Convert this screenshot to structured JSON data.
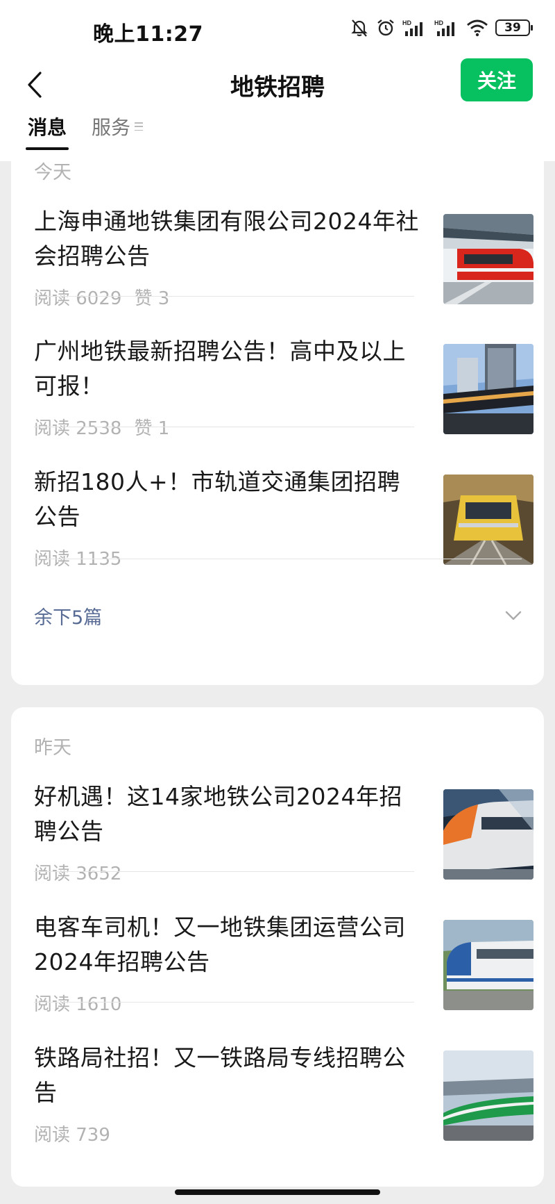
{
  "status_bar": {
    "time": "晚上11:27",
    "battery": "39",
    "icons": [
      "mute-bell-icon",
      "alarm-icon",
      "signal-hd-icon",
      "signal-hd-icon",
      "wifi-icon",
      "battery-icon"
    ]
  },
  "header": {
    "title": "地铁招聘",
    "follow_label": "关注",
    "back_icon": "chevron-left-icon"
  },
  "tabs": [
    {
      "label": "消息",
      "active": true
    },
    {
      "label": "服务",
      "active": false
    }
  ],
  "groups": [
    {
      "date": "今天",
      "articles": [
        {
          "title": "上海申通地铁集团有限公司2024年社会招聘公告",
          "reads": "阅读 6029",
          "likes": "赞 3",
          "thumb": "red-metro-platform"
        },
        {
          "title": "广州地铁最新招聘公告！高中及以上可报！",
          "reads": "阅读 2538",
          "likes": "赞 1",
          "thumb": "elevated-train-city"
        },
        {
          "title": "新招180人+！市轨道交通集团招聘公告",
          "reads": "阅读 1135",
          "likes": "",
          "thumb": "yellow-train-tunnel"
        }
      ],
      "more_label": "余下5篇"
    },
    {
      "date": "昨天",
      "articles": [
        {
          "title": "好机遇！这14家地铁公司2024年招聘公告",
          "reads": "阅读 3652",
          "likes": "",
          "thumb": "white-orange-train"
        },
        {
          "title": "电客车司机！又一地铁集团运营公司2024年招聘公告",
          "reads": "阅读 1610",
          "likes": "",
          "thumb": "blue-white-train"
        },
        {
          "title": "铁路局社招！又一铁路局专线招聘公告",
          "reads": "阅读 739",
          "likes": "",
          "thumb": "green-train-bridge"
        }
      ]
    }
  ],
  "colors": {
    "accent_green": "#07c160",
    "link_blue": "#576b95",
    "meta_gray": "#b2b2b2",
    "background": "#ededed"
  }
}
